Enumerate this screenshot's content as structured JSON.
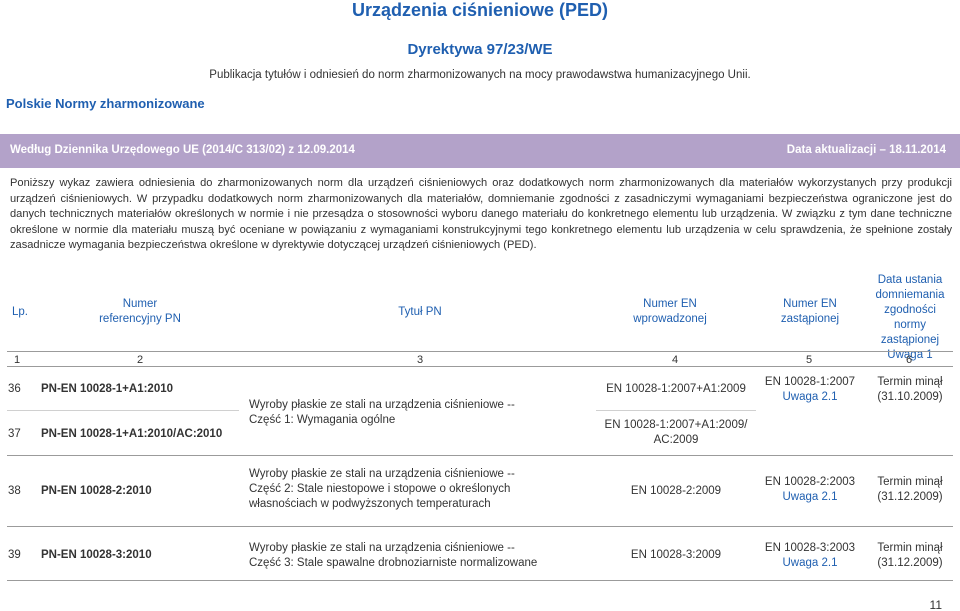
{
  "header": {
    "title": "Urządzenia ciśnieniowe (PED)",
    "directive": "Dyrektywa 97/23/WE",
    "publication": "Publikacja tytułów i odniesień do norm zharmonizowanych na mocy prawodawstwa humanizacyjnego Unii.",
    "organization": "Polskie Normy zharmonizowane"
  },
  "bar": {
    "left": "Według Dziennika Urzędowego UE (2014/C 313/02) z 12.09.2014",
    "right": "Data aktualizacji – 18.11.2014"
  },
  "intro": "Poniższy wykaz zawiera odniesienia do zharmonizowanych norm dla urządzeń ciśnieniowych oraz dodatkowych norm zharmonizowanych dla materiałów wykorzystanych przy produkcji urządzeń ciśnieniowych. W przypadku dodatkowych norm zharmonizowanych dla materiałów, domniemanie zgodności z zasadniczymi wymaganiami bezpieczeństwa ograniczone jest do danych technicznych materiałów określonych w normie i nie przesądza o stosowności wyboru danego materiału do konkretnego elementu lub urządzenia. W związku z tym dane techniczne określone w normie dla materiału muszą być oceniane w powiązaniu z wymaganiami konstrukcyjnymi tego konkretnego elementu lub urządzenia w celu sprawdzenia, że spełnione zostały zasadnicze wymagania bezpieczeństwa określone w dyrektywie dotyczącej urządzeń ciśnieniowych (PED).",
  "table": {
    "headers": {
      "lp": "Lp.",
      "ref_1": "Numer",
      "ref_2": "referencyjny PN",
      "title": "Tytuł PN",
      "introduced_1": "Numer EN",
      "introduced_2": "wprowadzonej",
      "replaced_1": "Numer EN",
      "replaced_2": "zastąpionej",
      "date_1": "Data ustania",
      "date_2": "domniemania",
      "date_3": "zgodności",
      "date_4": "normy",
      "date_5": "zastąpionej",
      "date_note": "Uwaga 1"
    },
    "col_numbers": [
      "1",
      "2",
      "3",
      "4",
      "5",
      "6"
    ],
    "rows": {
      "r36": {
        "lp": "36",
        "ref": "PN-EN 10028-1+A1:2010",
        "introduced": "EN 10028-1:2007+A1:2009"
      },
      "r37": {
        "lp": "37",
        "ref": "PN-EN 10028-1+A1:2010/AC:2010",
        "introduced_1": "EN 10028-1:2007+A1:2009/",
        "introduced_2": "AC:2009"
      },
      "group_36_37": {
        "title_1": "Wyroby płaskie ze stali na urządzenia ciśnieniowe --",
        "title_2": "Część 1: Wymagania ogólne",
        "replaced": "EN 10028-1:2007",
        "replaced_note": "Uwaga 2.1",
        "date_1": "Termin minął",
        "date_2": "(31.10.2009)"
      },
      "r38": {
        "lp": "38",
        "ref": "PN-EN 10028-2:2010",
        "title_1": "Wyroby płaskie ze stali na urządzenia ciśnieniowe --",
        "title_2": "Część 2: Stale niestopowe i stopowe o określonych",
        "title_3": "własnościach w podwyższonych temperaturach",
        "introduced": "EN 10028-2:2009",
        "replaced": "EN 10028-2:2003",
        "replaced_note": "Uwaga 2.1",
        "date_1": "Termin minął",
        "date_2": "(31.12.2009)"
      },
      "r39": {
        "lp": "39",
        "ref": "PN-EN 10028-3:2010",
        "title_1": "Wyroby płaskie ze stali na urządzenia ciśnieniowe --",
        "title_2": "Część 3: Stale spawalne drobnoziarniste normalizowane",
        "introduced": "EN 10028-3:2009",
        "replaced": "EN 10028-3:2003",
        "replaced_note": "Uwaga 2.1",
        "date_1": "Termin minął",
        "date_2": "(31.12.2009)"
      }
    }
  },
  "page_number": "11"
}
